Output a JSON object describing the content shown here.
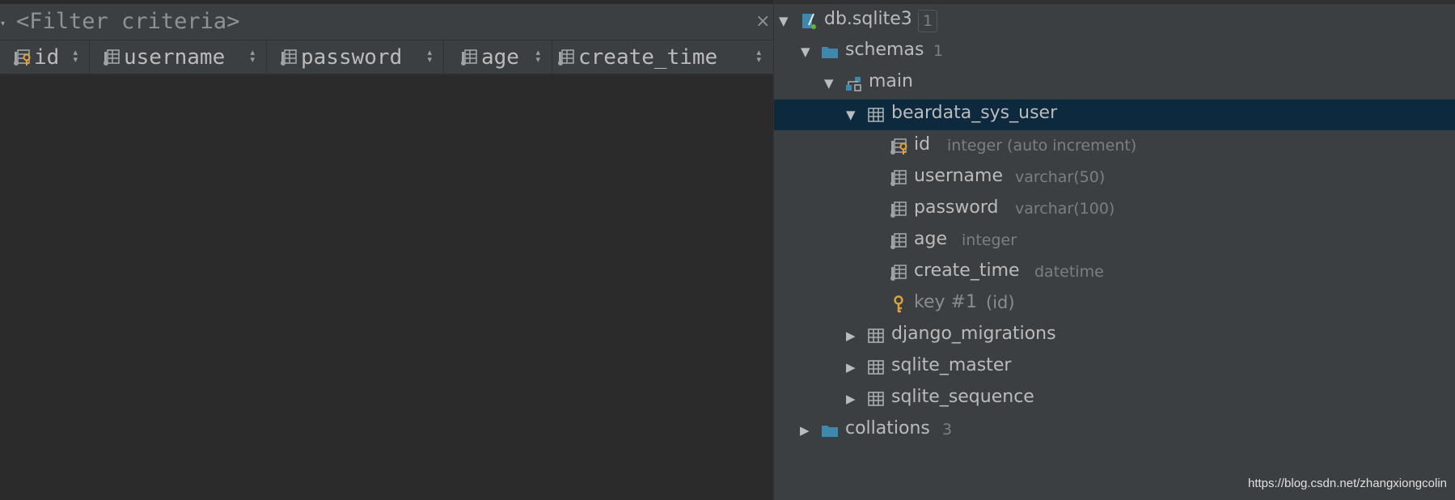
{
  "filter": {
    "placeholder": "<Filter criteria>"
  },
  "grid_columns": [
    {
      "label": "id",
      "icon": "primary-key-column-icon"
    },
    {
      "label": "username",
      "icon": "column-icon"
    },
    {
      "label": "password",
      "icon": "column-icon"
    },
    {
      "label": "age",
      "icon": "column-icon"
    },
    {
      "label": "create_time",
      "icon": "column-icon"
    }
  ],
  "tree": {
    "database": {
      "label": "db.sqlite3",
      "badge": "1",
      "icon": "sqlite-database-icon"
    },
    "schemas": {
      "label": "schemas",
      "count": "1",
      "icon": "folder-icon"
    },
    "main": {
      "label": "main",
      "icon": "schema-icon"
    },
    "table": {
      "label": "beardata_sys_user",
      "icon": "table-icon"
    },
    "columns": [
      {
        "name": "id",
        "type": "integer (auto increment)",
        "icon": "primary-key-column-icon"
      },
      {
        "name": "username",
        "type": "varchar(50)",
        "icon": "column-icon"
      },
      {
        "name": "password",
        "type": "varchar(100)",
        "icon": "column-icon"
      },
      {
        "name": "age",
        "type": "integer",
        "icon": "column-icon"
      },
      {
        "name": "create_time",
        "type": "datetime",
        "icon": "column-icon"
      }
    ],
    "key": {
      "label": "key #1",
      "detail": "(id)",
      "icon": "key-icon"
    },
    "other_tables": [
      {
        "label": "django_migrations"
      },
      {
        "label": "sqlite_master"
      },
      {
        "label": "sqlite_sequence"
      }
    ],
    "collations": {
      "label": "collations",
      "count": "3",
      "icon": "folder-icon"
    }
  },
  "colors": {
    "selection": "#0d293e",
    "background": "#3c3f41",
    "editor": "#2b2b2b",
    "folder": "#3f88ad",
    "key": "#e0a33a"
  },
  "watermark": "https://blog.csdn.net/zhangxiongcolin"
}
